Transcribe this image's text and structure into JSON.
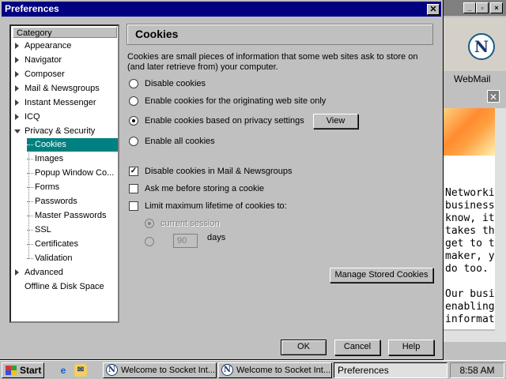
{
  "dialog": {
    "title": "Preferences",
    "close_glyph": "✕"
  },
  "tree": {
    "header": "Category",
    "items": [
      {
        "label": "Appearance",
        "expanded": false
      },
      {
        "label": "Navigator",
        "expanded": false
      },
      {
        "label": "Composer",
        "expanded": false
      },
      {
        "label": "Mail & Newsgroups",
        "expanded": false
      },
      {
        "label": "Instant Messenger",
        "expanded": false
      },
      {
        "label": "ICQ",
        "expanded": false
      },
      {
        "label": "Privacy & Security",
        "expanded": true
      }
    ],
    "privacy_children": [
      "Cookies",
      "Images",
      "Popup Window Co...",
      "Forms",
      "Passwords",
      "Master Passwords",
      "SSL",
      "Certificates",
      "Validation"
    ],
    "selected": "Cookies",
    "after_items": [
      {
        "label": "Advanced",
        "expanded": false,
        "has_children": true
      },
      {
        "label": "Offline & Disk Space",
        "has_children": false
      }
    ]
  },
  "panel": {
    "title": "Cookies",
    "description": "Cookies are small pieces of information that some web sites ask to store on (and later retrieve from) your computer.",
    "radio_options": [
      {
        "label": "Disable cookies",
        "checked": false
      },
      {
        "label": "Enable cookies for the originating web site only",
        "checked": false
      },
      {
        "label": "Enable cookies based on privacy settings",
        "checked": true
      },
      {
        "label": "Enable all cookies",
        "checked": false
      }
    ],
    "view_button": "View",
    "checkboxes": [
      {
        "label": "Disable cookies in Mail & Newsgroups",
        "checked": true
      },
      {
        "label": "Ask me before storing a cookie",
        "checked": false
      },
      {
        "label": "Limit maximum lifetime of cookies to:",
        "checked": false
      }
    ],
    "lifetime": {
      "current_session": "current session",
      "days_value": "90",
      "days_label": "days"
    },
    "manage_button": "Manage Stored Cookies"
  },
  "buttons": {
    "ok": "OK",
    "cancel": "Cancel",
    "help": "Help"
  },
  "background_window": {
    "webmail": "WebMail",
    "text_lines": [
      "Networkin",
      "business.",
      "know, it's",
      "takes the",
      "get to th",
      "maker, yo",
      "do too.",
      "",
      "Our busin",
      "enabling ",
      "informatio"
    ]
  },
  "taskbar": {
    "start": "Start",
    "tasks": [
      "Welcome to Socket Int...",
      "Welcome to Socket Int..."
    ],
    "active_task": "Preferences",
    "clock": "8:58 AM"
  }
}
